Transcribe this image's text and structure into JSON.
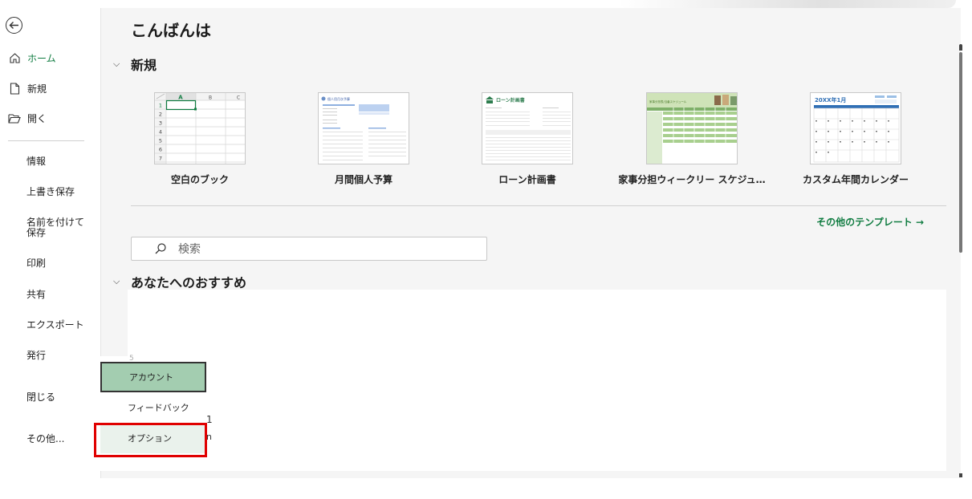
{
  "main": {
    "greeting": "こんばんは",
    "new_section": {
      "title": "新規",
      "templates": [
        {
          "label": "空白のブック"
        },
        {
          "label": "月間個人予算",
          "thumb_title": "個人用月次予算"
        },
        {
          "label": "ローン計画書",
          "thumb_title": "ローン計画書"
        },
        {
          "label": "家事分担ウィークリー スケジュ…",
          "thumb_title": "家事分担表/当番スケジュール"
        },
        {
          "label": "カスタム年間カレンダー",
          "thumb_title": "20XX年1月"
        }
      ],
      "grid": {
        "cols": [
          "A",
          "B",
          "C"
        ],
        "rows": [
          "1",
          "2",
          "3",
          "4",
          "5",
          "6",
          "7"
        ]
      },
      "more_templates": "その他のテンプレート →"
    },
    "search": {
      "placeholder": "検索"
    },
    "recommend_section": {
      "title": "あなたへのおすすめ"
    }
  },
  "sidebar": {
    "back_icon": "back-arrow-icon",
    "primary": [
      {
        "label": "ホーム",
        "icon": "home-icon",
        "active": true
      },
      {
        "label": "新規",
        "icon": "new-document-icon"
      },
      {
        "label": "開く",
        "icon": "open-folder-icon"
      }
    ],
    "secondary": [
      {
        "label": "情報"
      },
      {
        "label": "上書き保存"
      },
      {
        "label": "名前を付けて保存"
      },
      {
        "label": "印刷"
      },
      {
        "label": "共有"
      },
      {
        "label": "エクスポート"
      },
      {
        "label": "発行"
      },
      {
        "label": "閉じる"
      },
      {
        "label": "その他..."
      }
    ]
  },
  "popup": {
    "items": [
      {
        "label": "アカウント"
      },
      {
        "label": "フィードバック"
      },
      {
        "label": "オプション"
      }
    ],
    "peek": [
      "5",
      "1",
      "n"
    ]
  },
  "colors": {
    "accent": "#107c41",
    "highlight": "#e00000",
    "account_bg": "#a3cdb0"
  }
}
